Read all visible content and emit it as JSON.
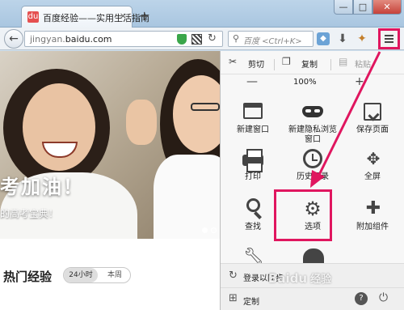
{
  "tab": {
    "title": "百度经验——实用生活指南",
    "favicon": "du",
    "close": "×"
  },
  "new_tab": "+",
  "window_controls": {
    "minimize": "—",
    "maximize": "□",
    "close": "✕"
  },
  "nav": {
    "url_host": "jingyan.",
    "url_domain": "baidu.com",
    "search_placeholder": "百度 <Ctrl+K>",
    "back_glyph": "←",
    "reload_glyph": "↻"
  },
  "page": {
    "hero_title": "考加油！",
    "hero_sub": "的高考宝典！",
    "section_title": "热门经验",
    "tab_24h": "24小时",
    "tab_week": "本周"
  },
  "menu": {
    "edit": {
      "cut": "剪切",
      "copy": "复制",
      "paste": "粘贴"
    },
    "zoom": {
      "minus": "—",
      "value": "100%",
      "plus": "+"
    },
    "items": [
      {
        "label": "新建窗口",
        "icon": "new-window-icon"
      },
      {
        "label": "新建隐私浏览窗口",
        "icon": "private-mask-icon"
      },
      {
        "label": "保存页面",
        "icon": "save-page-icon"
      },
      {
        "label": "打印",
        "icon": "printer-icon"
      },
      {
        "label": "历史记录",
        "icon": "history-clock-icon"
      },
      {
        "label": "全屏",
        "icon": "fullscreen-icon"
      },
      {
        "label": "查找",
        "icon": "magnifier-icon"
      },
      {
        "label": "选项",
        "icon": "gear-icon"
      },
      {
        "label": "附加组件",
        "icon": "puzzle-icon"
      }
    ],
    "sync": "登录以同步",
    "customize": "定制"
  },
  "watermark": {
    "brand": "Baidu",
    "suffix": "经验"
  },
  "colors": {
    "highlight": "#e0165f",
    "titlebar": "#a9c6e0"
  }
}
